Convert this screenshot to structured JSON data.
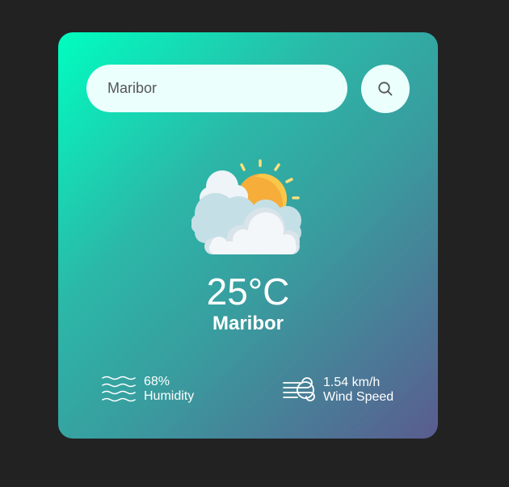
{
  "search": {
    "value": "Maribor",
    "icon": "search-icon"
  },
  "weather": {
    "icon": "partly-cloudy-icon",
    "temperature": "25°C",
    "city": "Maribor"
  },
  "humidity": {
    "icon": "humidity-icon",
    "value": "68%",
    "label": "Humidity"
  },
  "wind": {
    "icon": "wind-icon",
    "value": "1.54 km/h",
    "label": "Wind Speed"
  },
  "colors": {
    "page_background": "#222222",
    "card_gradient_start": "#00fec0",
    "card_gradient_end": "#5a5c8f",
    "input_background": "#ebfffc",
    "sun": "#f9c33d",
    "text": "#ffffff"
  }
}
